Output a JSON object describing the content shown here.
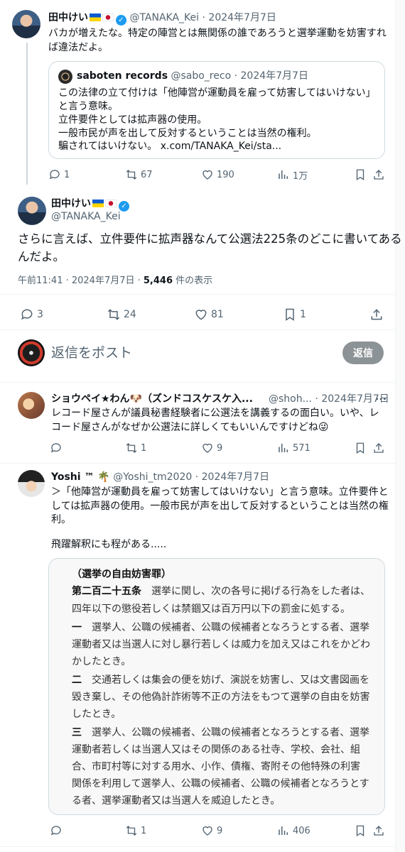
{
  "tweet1": {
    "name": "田中けい",
    "handle": "@TANAKA_Kei",
    "dot": "·",
    "date": "2024年7月7日",
    "text_lines": [
      "バカが増えたな。特定の陣営とは無関係の誰であろうと選挙運動を妨害すれ",
      "ば違法だよ。"
    ],
    "quote": {
      "name": "saboten records",
      "handle": "@sabo_reco",
      "date": "2024年7月7日",
      "lines": [
        "この法律の立て付けは「他陣営が運動員を雇って妨害してはいけない」",
        "と言う意味。",
        "立件要件としては拡声器の使用。",
        "一般市民が声を出して反対するということは当然の権利。",
        "騙されてはいけない。 x.com/TANAKA_Kei/sta..."
      ]
    },
    "stats": {
      "replies": "1",
      "retweets": "67",
      "likes": "190",
      "views": "1万"
    }
  },
  "tweet2": {
    "name": "田中けい",
    "handle": "@TANAKA_Kei",
    "text_lines": [
      "さらに言えば、立件要件に拡声器なんて公選法225条のどこに書いてある",
      "んだよ。"
    ],
    "time": "午前11:41 · 2024年7月7日 · ",
    "views_count": "5,446",
    "views_suffix": " 件の表示",
    "stats": {
      "replies": "3",
      "retweets": "24",
      "likes": "81",
      "bookmarks": "1"
    }
  },
  "composer": {
    "placeholder": "返信をポスト",
    "button": "返信"
  },
  "reply1": {
    "name": "ショウペイ★わん🐶（ズンドコスケスケ入...",
    "handle": "@shoh...",
    "date": "2024年7月7日",
    "text_lines": [
      "レコード屋さんが議員秘書経験者に公選法を講義するの面白い。いや、レ",
      "コード屋さんがなぜか公選法に詳しくてもいいんですけどね😜"
    ],
    "stats": {
      "retweets": "1",
      "likes": "9",
      "views": "571"
    }
  },
  "reply2": {
    "name": "Yoshi ™ 🌴",
    "handle": "@Yoshi_tm2020",
    "date": "2024年7月7日",
    "text_lines": [
      "＞「他陣営が運動員を雇って妨害してはいけない」と言う意味。立件要件と",
      "しては拡声器の使用。一般市民が声を出して反対するということは当然の権",
      "利。",
      "",
      "飛躍解釈にも程がある....."
    ],
    "image_text": [
      {
        "b": "（選挙の自由妨害罪）",
        "t": ""
      },
      {
        "b": "第二百二十五条",
        "t": "　選挙に関し、次の各号に掲げる行為をした者は、"
      },
      {
        "b": "",
        "t": "四年以下の懲役若しくは禁錮又は百万円以下の罰金に処する。"
      },
      {
        "b": "一",
        "t": "　選挙人、公職の候補者、公職の候補者となろうとする者、選挙"
      },
      {
        "b": "",
        "t": "運動者又は当選人に対し暴行若しくは威力を加え又はこれをかどわ"
      },
      {
        "b": "",
        "t": "かしたとき。"
      },
      {
        "b": "二",
        "t": "　交通若しくは集会の便を妨げ、演説を妨害し、又は文書図画を"
      },
      {
        "b": "",
        "t": "毀き棄し、その他偽計詐術等不正の方法をもつて選挙の自由を妨害"
      },
      {
        "b": "",
        "t": "したとき。"
      },
      {
        "b": "三",
        "t": "　選挙人、公職の候補者、公職の候補者となろうとする者、選挙"
      },
      {
        "b": "",
        "t": "運動者若しくは当選人又はその関係のある社寺、学校、会社、組"
      },
      {
        "b": "",
        "t": "合、市町村等に対する用水、小作、債権、寄附その他特殊の利害"
      },
      {
        "b": "",
        "t": "関係を利用して選挙人、公職の候補者、公職の候補者となろうとす"
      },
      {
        "b": "",
        "t": "る者、選挙運動者又は当選人を威迫したとき。"
      }
    ],
    "stats": {
      "retweets": "1",
      "likes": "9",
      "views": "406"
    }
  }
}
